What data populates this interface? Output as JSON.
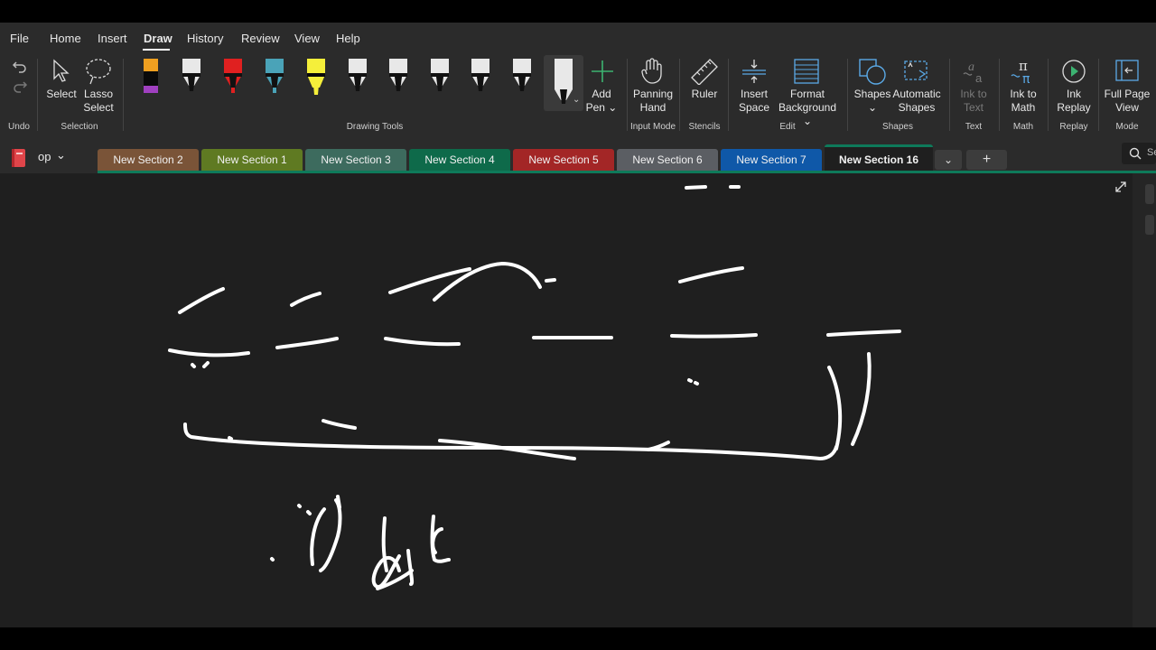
{
  "menu": {
    "file": "File",
    "home": "Home",
    "insert": "Insert",
    "draw": "Draw",
    "history": "History",
    "review": "Review",
    "view": "View",
    "help": "Help"
  },
  "ribbon": {
    "undo_group": "Undo",
    "select": "Select",
    "lasso_l1": "Lasso",
    "lasso_l2": "Select",
    "selection_group": "Selection",
    "add_pen_l1": "Add",
    "add_pen_l2": "Pen ⌄",
    "drawing_tools_group": "Drawing Tools",
    "panning_l1": "Panning",
    "panning_l2": "Hand",
    "input_mode_group": "Input Mode",
    "ruler": "Ruler",
    "stencils_group": "Stencils",
    "insert_space_l1": "Insert",
    "insert_space_l2": "Space",
    "format_bg_l1": "Format",
    "format_bg_l2": "Background ⌄",
    "edit_group": "Edit",
    "shapes": "Shapes",
    "auto_shapes_l1": "Automatic",
    "auto_shapes_l2": "Shapes",
    "shapes_group": "Shapes",
    "ink_text_l1": "Ink to",
    "ink_text_l2": "Text",
    "text_group": "Text",
    "ink_math_l1": "Ink to",
    "ink_math_l2": "Math",
    "math_group": "Math",
    "ink_replay_l1": "Ink",
    "ink_replay_l2": "Replay",
    "replay_group": "Replay",
    "full_page_l1": "Full Page",
    "full_page_l2": "View",
    "mode_group": "Mode"
  },
  "pens": [
    {
      "cap": "#e8e8e8",
      "tip": "#111111",
      "band": "#111111"
    },
    {
      "cap": "#e02020",
      "tip": "#111111",
      "band": "#111111"
    },
    {
      "cap": "#4aa3b8",
      "tip": "#111111",
      "band": "#111111"
    },
    {
      "cap": "#e8e8e8",
      "tip": "#111111",
      "band": "#111111"
    },
    {
      "cap": "#e8e8e8",
      "tip": "#111111",
      "band": "#111111"
    },
    {
      "cap": "#e8e8e8",
      "tip": "#111111",
      "band": "#111111"
    },
    {
      "cap": "#e8e8e8",
      "tip": "#111111",
      "band": "#111111"
    },
    {
      "cap": "#e8e8e8",
      "tip": "#111111",
      "band": "#111111"
    }
  ],
  "notebook": {
    "name": "op"
  },
  "tabs": [
    {
      "label": "New Section 2",
      "color": "#7a5438"
    },
    {
      "label": "New Section 1",
      "color": "#5f7a22"
    },
    {
      "label": "New Section 3",
      "color": "#3d6b5e"
    },
    {
      "label": "New Section 4",
      "color": "#0e6a4a"
    },
    {
      "label": "New Section 5",
      "color": "#a32626"
    },
    {
      "label": "New Section 6",
      "color": "#5b5e63"
    },
    {
      "label": "New Section 7",
      "color": "#0f58a8"
    },
    {
      "label": "New Section 16",
      "color": "#0e7a5a"
    }
  ],
  "search": {
    "placeholder": "Se"
  }
}
